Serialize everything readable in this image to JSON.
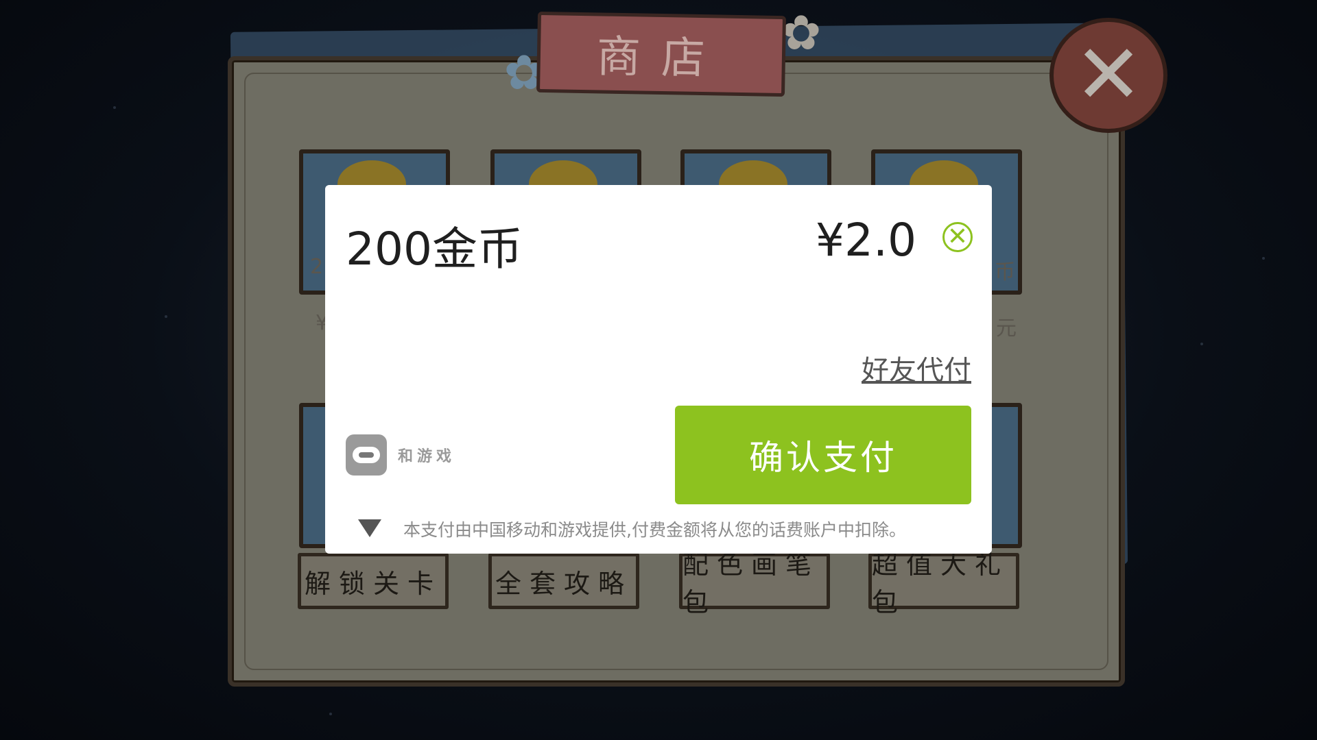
{
  "shop": {
    "title": "商店",
    "tile_labels": [
      "解锁关卡",
      "全套攻略",
      "配色画笔包",
      "超值大礼包"
    ],
    "fragments": [
      "2",
      "¥",
      "币",
      "元"
    ]
  },
  "dialog": {
    "item": "200金币",
    "price": "¥2.0",
    "friend_pay": "好友代付",
    "brand": "和游戏",
    "confirm": "确认支付",
    "note": "本支付由中国移动和游戏提供,付费金额将从您的话费账户中扣除。"
  },
  "colors": {
    "accent": "#8dc21f",
    "overlay_bg": "#070b12",
    "ribbon": "#8a4f4f"
  },
  "icons": {
    "game_close": "close-x-icon",
    "dialog_close": "circle-close-icon",
    "expand": "triangle-down-icon",
    "brand_logo": "robot-face-icon"
  }
}
